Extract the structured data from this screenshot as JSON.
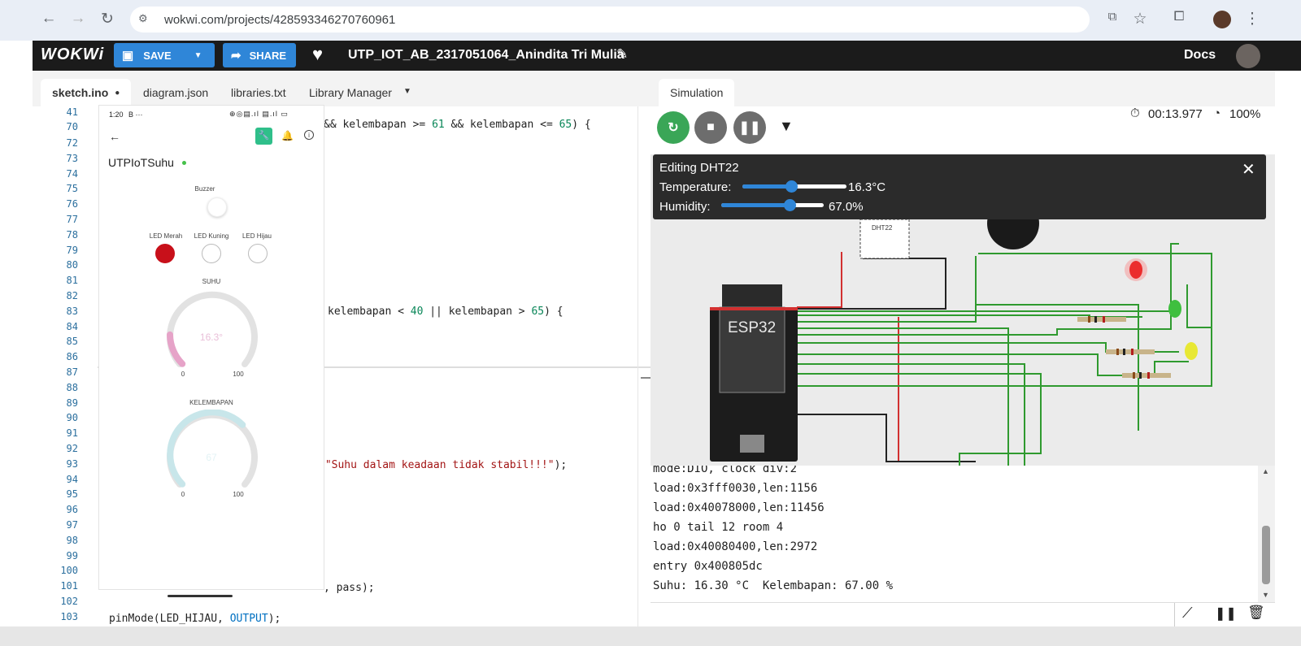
{
  "browser": {
    "url": "wokwi.com/projects/428593346270760961"
  },
  "header": {
    "logo": "WOKWi",
    "save": "SAVE",
    "share": "SHARE",
    "project_title": "UTP_IOT_AB_2317051064_Anindita Tri Mulia",
    "docs": "Docs"
  },
  "tabs": [
    "sketch.ino",
    "diagram.json",
    "libraries.txt",
    "Library Manager"
  ],
  "editor": {
    "line_numbers": [
      "41",
      "70",
      "72",
      "73",
      "74",
      "75",
      "76",
      "77",
      "78",
      "79",
      "80",
      "81",
      "82",
      "83",
      "84",
      "85",
      "86",
      "87",
      "88",
      "89",
      "90",
      "91",
      "92",
      "93",
      "94",
      "95",
      "96",
      "97",
      "98",
      "99",
      "100",
      "101",
      "102",
      "103"
    ],
    "fragments": {
      "l70a": "&& kelembapan >= ",
      "l70b": "61",
      " l70c": " && kelembapan <= ",
      "l70d": "65",
      "l70e": ") {",
      "l83a": "kelembapan < ",
      "l83b": "40",
      "l83c": " || kelembapan > ",
      "l83d": "65",
      "l83e": ") {",
      "l93a": "(",
      "l93b": "\"Suhu dalam keadaan tidak stabil!!!\"",
      "l93c": ");",
      "l101": ", pass);",
      "l103a": "pinMode(LED_HIJAU, ",
      "l103b": "OUTPUT",
      "l103c": ");"
    }
  },
  "phone": {
    "time": "1:20",
    "time_b": "B ···",
    "title": "UTPIoTSuhu",
    "buzzer": "Buzzer",
    "led_merah": "LED Merah",
    "led_kuning": "LED Kuning",
    "led_hijau": "LED Hijau",
    "suhu_label": "SUHU",
    "suhu_value": "16.3°",
    "gauge_min": "0",
    "gauge_max": "100",
    "kelembapan_label": "KELEMBAPAN",
    "kelembapan_value": "67",
    "suhu_level": 16.3,
    "kelembapan_level": 67
  },
  "simulation": {
    "tab": "Simulation",
    "timer": "00:13.977",
    "speed": "100%"
  },
  "edit_panel": {
    "title": "Editing DHT22",
    "temp_label": "Temperature:",
    "temp_value": "16.3°C",
    "temp_level": 0.47,
    "hum_label": "Humidity:",
    "hum_value": "67.0%",
    "hum_level": 0.67
  },
  "diagram": {
    "sensor": "DHT22",
    "board": "ESP32"
  },
  "serial": [
    "mode:DIO, clock div:2",
    "load:0x3fff0030,len:1156",
    "load:0x40078000,len:11456",
    "ho 0 tail 12 room 4",
    "load:0x40080400,len:2972",
    "entry 0x400805dc",
    "Suhu: 16.30 °C  Kelembapan: 67.00 %"
  ],
  "colors": {
    "accent": "#2f86d8",
    "play": "#3aa657",
    "header": "#1b1b1b",
    "led_red": "#d81414",
    "led_green": "#3fbf3f",
    "led_yellow": "#e8e834"
  }
}
